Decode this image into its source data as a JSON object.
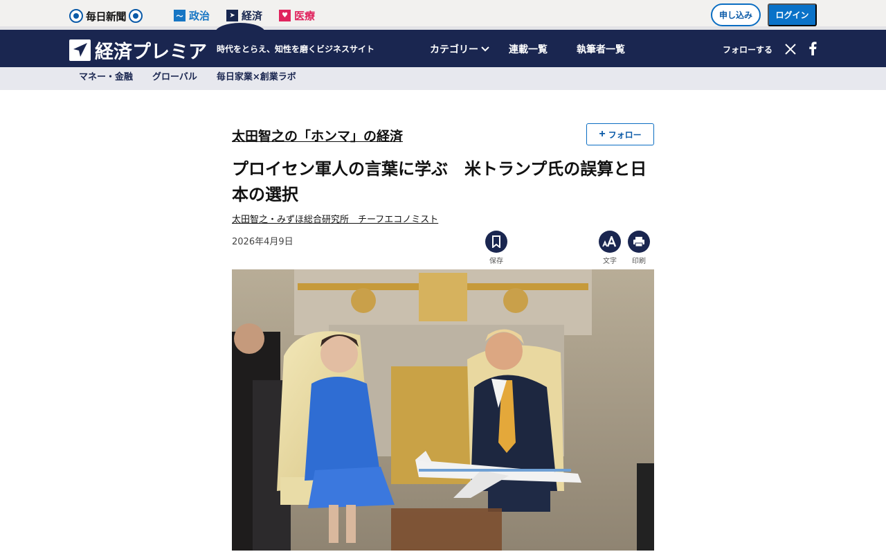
{
  "topbar": {
    "mainichi_logo_text": "毎日新聞",
    "site_tabs": [
      {
        "label": "政治",
        "color": "#1776c4"
      },
      {
        "label": "経済",
        "color": "#17264f"
      },
      {
        "label": "医療",
        "color": "#e0245e"
      }
    ],
    "apply_label": "申し込み",
    "login_label": "ログイン"
  },
  "header": {
    "brand_name": "経済プレミア",
    "tagline": "時代をとらえ、知性を磨くビジネスサイト",
    "nav": {
      "category_label": "カテゴリー",
      "serial_label": "連載一覧",
      "writers_label": "執筆者一覧"
    },
    "follow_label": "フォローする",
    "social_icons": [
      "x-icon",
      "facebook-icon"
    ],
    "bg_color": "#1a2650"
  },
  "subnav": {
    "items": [
      "マネー・金融",
      "グローバル",
      "毎日家業×創業ラボ"
    ]
  },
  "article": {
    "series_title": "太田智之の「ホンマ」の経済",
    "follow_button": "フォロー",
    "headline": "プロイセン軍人の言葉に学ぶ　米トランプ氏の誤算と日本の選択",
    "author": "太田智之・みずほ総合研究所　チーフエコノミスト",
    "date": "2026年4月9日",
    "tools": {
      "save_label": "保存",
      "font_label": "文字",
      "print_label": "印刷"
    }
  },
  "accent_colors": {
    "primary": "#0a6dc2",
    "navy": "#1a2650"
  }
}
